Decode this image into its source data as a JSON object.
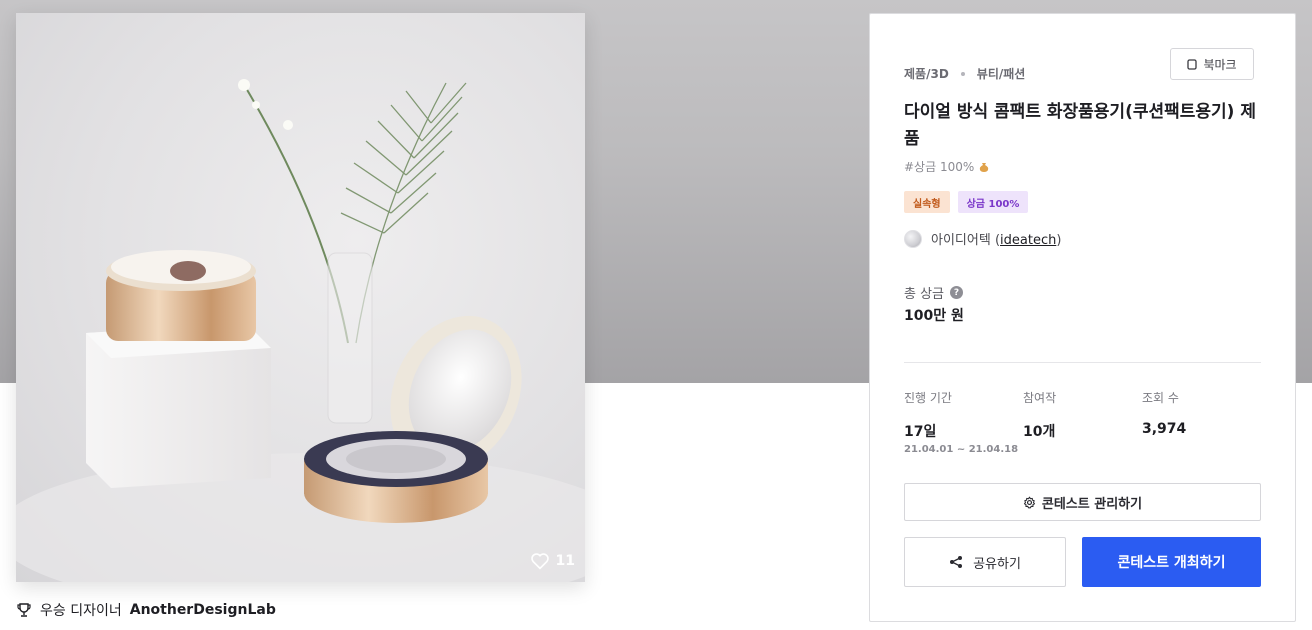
{
  "product": {
    "likes": "11"
  },
  "winner": {
    "label": "우승 디자이너",
    "name": "AnotherDesignLab"
  },
  "panel": {
    "category": "제품/3D",
    "subcategory": "뷰티/패션",
    "bookmark_label": "북마크",
    "title": "다이얼 방식 콤팩트 화장품용기(쿠션팩트용기) 제품",
    "prize_tag": "#상금 100%",
    "badges": [
      {
        "label": "실속형"
      },
      {
        "label": "상금 100%"
      }
    ],
    "host": {
      "name": "아이디어텍",
      "id": "ideatech"
    },
    "total_prize": {
      "label": "총 상금",
      "value": "100만 원"
    },
    "stats": {
      "period": {
        "label": "진행 기간",
        "value": "17일",
        "range": "21.04.01 ~ 21.04.18"
      },
      "entries": {
        "label": "참여작",
        "value": "10개"
      },
      "views": {
        "label": "조회 수",
        "value": "3,974"
      }
    },
    "manage_label": "콘테스트 관리하기",
    "share_label": "공유하기",
    "host_contest_label": "콘테스트 개최하기"
  },
  "colors": {
    "primary": "#2b5cf2",
    "badge_practical": "#fbe3d2",
    "badge_prize": "#eee3fb"
  }
}
